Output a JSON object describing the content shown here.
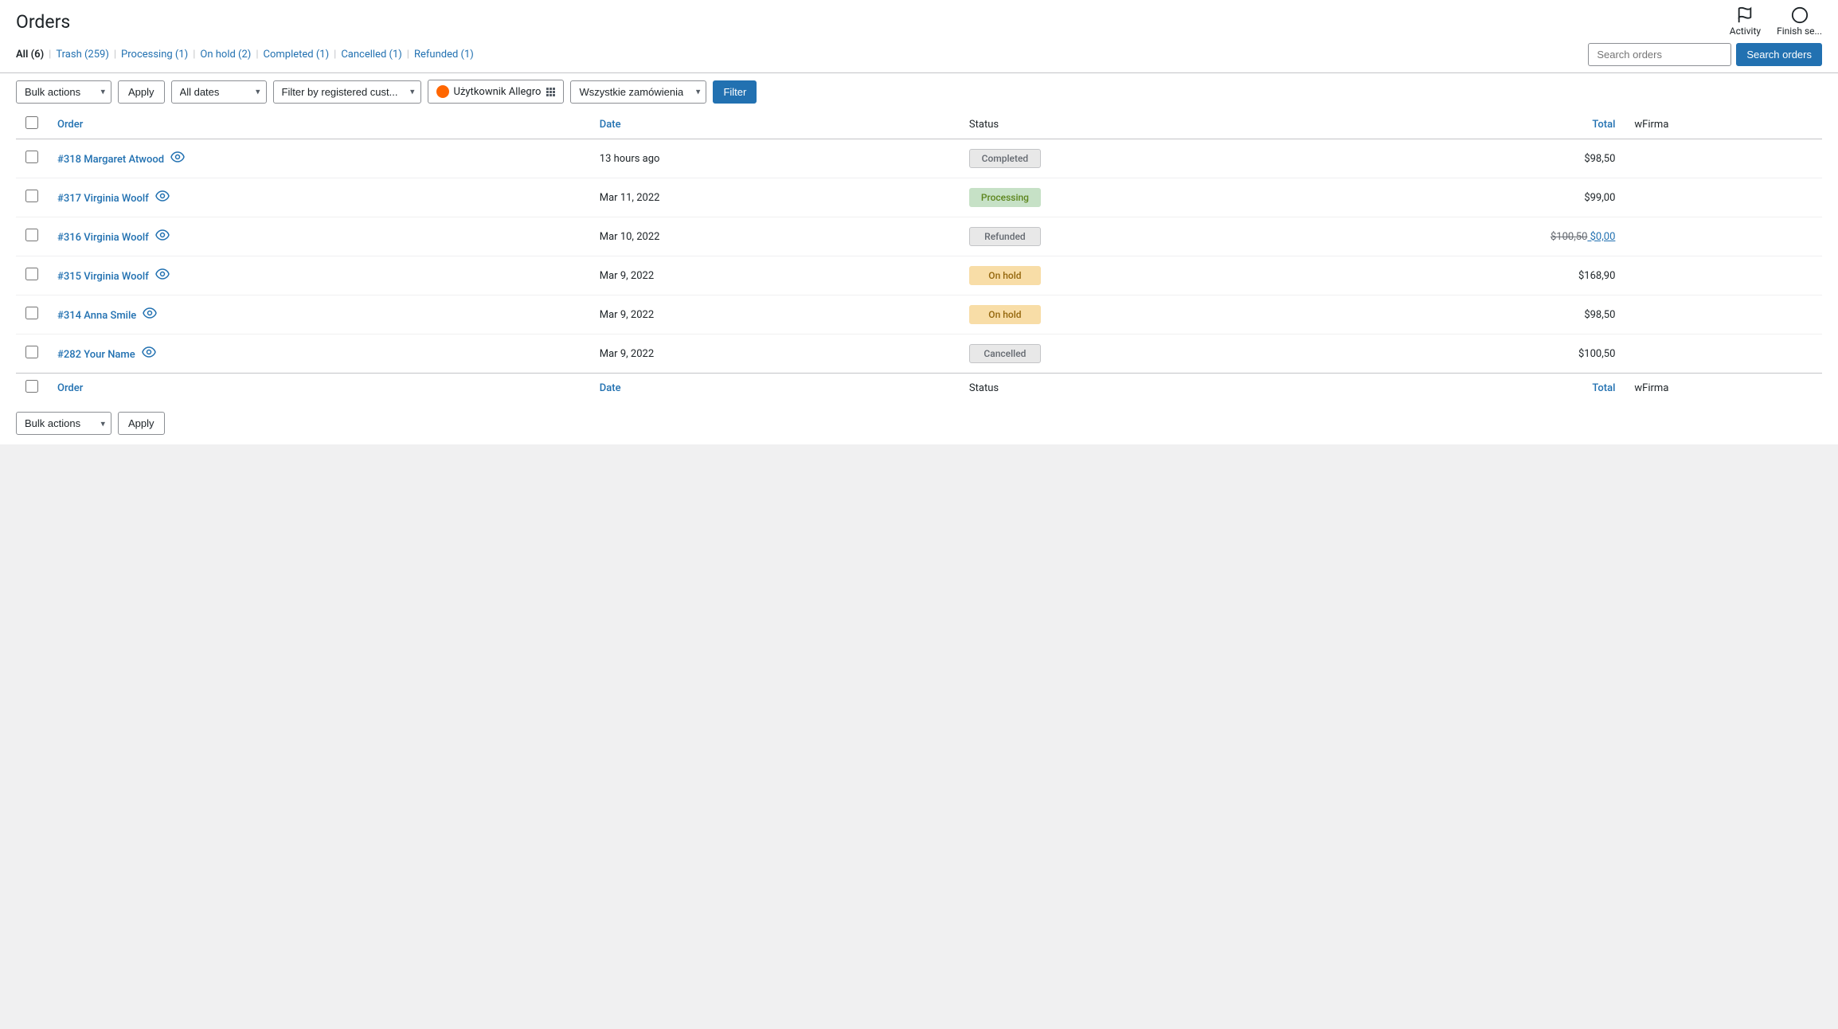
{
  "page": {
    "title": "Orders"
  },
  "header_actions": [
    {
      "id": "activity",
      "label": "Activity",
      "icon": "flag"
    },
    {
      "id": "finish-setup",
      "label": "Finish se...",
      "icon": "circle"
    }
  ],
  "filter_links": [
    {
      "id": "all",
      "label": "All",
      "count": 6,
      "active": true
    },
    {
      "id": "trash",
      "label": "Trash",
      "count": 259,
      "active": false
    },
    {
      "id": "processing",
      "label": "Processing",
      "count": 1,
      "active": false
    },
    {
      "id": "on-hold",
      "label": "On hold",
      "count": 2,
      "active": false
    },
    {
      "id": "completed",
      "label": "Completed",
      "count": 1,
      "active": false
    },
    {
      "id": "cancelled",
      "label": "Cancelled",
      "count": 1,
      "active": false
    },
    {
      "id": "refunded",
      "label": "Refunded",
      "count": 1,
      "active": false
    }
  ],
  "toolbar": {
    "bulk_actions_label": "Bulk actions",
    "apply_label": "Apply",
    "all_dates_label": "All dates",
    "filter_by_customer_placeholder": "Filter by registered cust...",
    "allegro_user_label": "Użytkownik Allegro",
    "wszystkie_label": "Wszystkie zamówienia",
    "filter_label": "Filter",
    "search_placeholder": "Search orders"
  },
  "table": {
    "columns": [
      {
        "id": "order",
        "label": "Order",
        "linked": true
      },
      {
        "id": "date",
        "label": "Date",
        "linked": true
      },
      {
        "id": "status",
        "label": "Status",
        "linked": false
      },
      {
        "id": "total",
        "label": "Total",
        "linked": true
      },
      {
        "id": "wfirma",
        "label": "wFirma",
        "linked": false
      }
    ],
    "rows": [
      {
        "id": "318",
        "order_label": "#318 Margaret Atwood",
        "date": "13 hours ago",
        "status": "Completed",
        "status_class": "status-completed",
        "total": "$98,50",
        "total_original": null,
        "total_discounted": null,
        "wfirma": ""
      },
      {
        "id": "317",
        "order_label": "#317 Virginia Woolf",
        "date": "Mar 11, 2022",
        "status": "Processing",
        "status_class": "status-processing",
        "total": "$99,00",
        "total_original": null,
        "total_discounted": null,
        "wfirma": ""
      },
      {
        "id": "316",
        "order_label": "#316 Virginia Woolf",
        "date": "Mar 10, 2022",
        "status": "Refunded",
        "status_class": "status-refunded",
        "total": null,
        "total_original": "$100,50",
        "total_discounted": "$0,00",
        "wfirma": ""
      },
      {
        "id": "315",
        "order_label": "#315 Virginia Woolf",
        "date": "Mar 9, 2022",
        "status": "On hold",
        "status_class": "status-on-hold",
        "total": "$168,90",
        "total_original": null,
        "total_discounted": null,
        "wfirma": ""
      },
      {
        "id": "314",
        "order_label": "#314 Anna Smile",
        "date": "Mar 9, 2022",
        "status": "On hold",
        "status_class": "status-on-hold",
        "total": "$98,50",
        "total_original": null,
        "total_discounted": null,
        "wfirma": ""
      },
      {
        "id": "282",
        "order_label": "#282 Your Name",
        "date": "Mar 9, 2022",
        "status": "Cancelled",
        "status_class": "status-cancelled",
        "total": "$100,50",
        "total_original": null,
        "total_discounted": null,
        "wfirma": ""
      }
    ]
  }
}
